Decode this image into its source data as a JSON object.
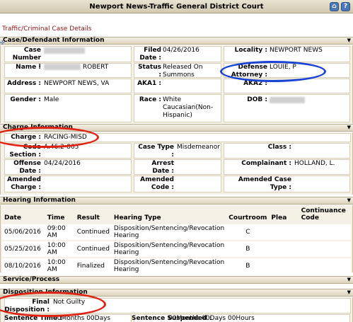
{
  "window": {
    "title": "Newport News-Traffic General District Court",
    "home_icon": "home-icon",
    "help_icon": "help-icon"
  },
  "breadcrumb": "Traffic/Criminal Case Details",
  "case_section": {
    "title": "Case/Defendant Information",
    "case_number_label": "Case Number :",
    "filed_date_label": "Filed Date :",
    "filed_date": "04/26/2016",
    "locality_label": "Locality :",
    "locality": "NEWPORT NEWS",
    "name_label": "Name :",
    "name_visible": "ROBERT",
    "status_label": "Status :",
    "status": "Released On Summons",
    "defense_label": "Defense Attorney :",
    "defense_attorney": "LOUIE, P",
    "address_label": "Address :",
    "address": "NEWPORT NEWS, VA",
    "aka1_label": "AKA1 :",
    "aka2_label": "AKA2 :",
    "gender_label": "Gender :",
    "gender": "Male",
    "race_label": "Race :",
    "race": "White Caucasian(Non-Hispanic)",
    "dob_label": "DOB :"
  },
  "charge_section": {
    "title": "Charge Information",
    "charge_label": "Charge :",
    "charge": "RACING-MISD",
    "code_section_label": "Code Section :",
    "code_section": "A.46.2-865",
    "case_type_label": "Case Type :",
    "case_type": "Misdemeanor",
    "class_label": "Class :",
    "offense_date_label": "Offense Date :",
    "offense_date": "04/24/2016",
    "arrest_date_label": "Arrest Date :",
    "complainant_label": "Complainant :",
    "complainant": "HOLLAND, L.",
    "amended_charge_label": "Amended Charge :",
    "amended_code_label": "Amended Code :",
    "amended_case_type_label": "Amended Case Type :"
  },
  "hearing_section": {
    "title": "Hearing Information",
    "columns": [
      "Date",
      "Time",
      "Result",
      "Hearing Type",
      "Courtroom",
      "Plea",
      "Continuance Code"
    ],
    "rows": [
      {
        "date": "05/06/2016",
        "time": "09:00 AM",
        "result": "Continued",
        "type": "Disposition/Sentencing/Revocation Hearing",
        "courtroom": "C",
        "plea": "",
        "continuance": ""
      },
      {
        "date": "05/25/2016",
        "time": "10:00 AM",
        "result": "Continued",
        "type": "Disposition/Sentencing/Revocation Hearing",
        "courtroom": "B",
        "plea": "",
        "continuance": ""
      },
      {
        "date": "08/10/2016",
        "time": "10:00 AM",
        "result": "Finalized",
        "type": "Disposition/Sentencing/Revocation Hearing",
        "courtroom": "B",
        "plea": "",
        "continuance": ""
      }
    ]
  },
  "service_section": {
    "title": "Service/Process"
  },
  "disposition_section": {
    "title": "Disposition Information",
    "final_disposition_label": "Final Disposition :",
    "final_disposition": "Not Guilty",
    "sentence_time_label": "Sentence Time :",
    "sentence_time": "00Months 00Days",
    "sentence_suspended_label": "Sentence Suspended :",
    "sentence_suspended": "00Months 00Days 00Hours"
  },
  "colors": {
    "annotation_blue": "#1a44d6",
    "annotation_red": "#e02212",
    "breadcrumb": "#8b1010"
  }
}
